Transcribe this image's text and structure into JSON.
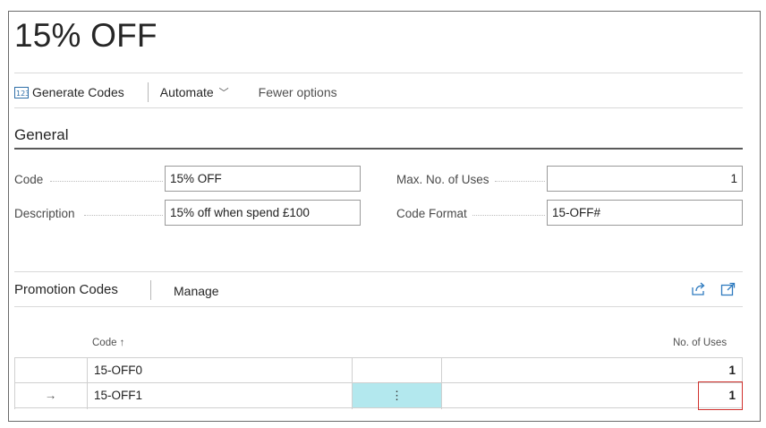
{
  "page": {
    "title": "15% OFF"
  },
  "actions": {
    "generate_codes": "Generate Codes",
    "automate": "Automate",
    "fewer_options": "Fewer options"
  },
  "general": {
    "section_title": "General",
    "code_label": "Code",
    "code_value": "15% OFF",
    "description_label": "Description",
    "description_value": "15% off when spend £100",
    "max_uses_label": "Max. No. of Uses",
    "max_uses_value": "1",
    "code_format_label": "Code Format",
    "code_format_value": "15-OFF#"
  },
  "promotion_codes": {
    "title": "Promotion Codes",
    "manage": "Manage",
    "columns": {
      "code": "Code ↑",
      "no_of_uses": "No. of Uses"
    },
    "rows": [
      {
        "marker": "",
        "code": "15-OFF0",
        "uses": "1"
      },
      {
        "marker": "→",
        "code": "15-OFF1",
        "uses": "1"
      }
    ],
    "kebab": "⋮"
  },
  "icons": {
    "generate": "generate-codes-icon",
    "share": "share-icon",
    "expand": "expand-icon"
  },
  "colors": {
    "selected_cell": "#b3e8ee",
    "highlight_border": "#d0312d",
    "accent_icon": "#2f7bbf"
  }
}
